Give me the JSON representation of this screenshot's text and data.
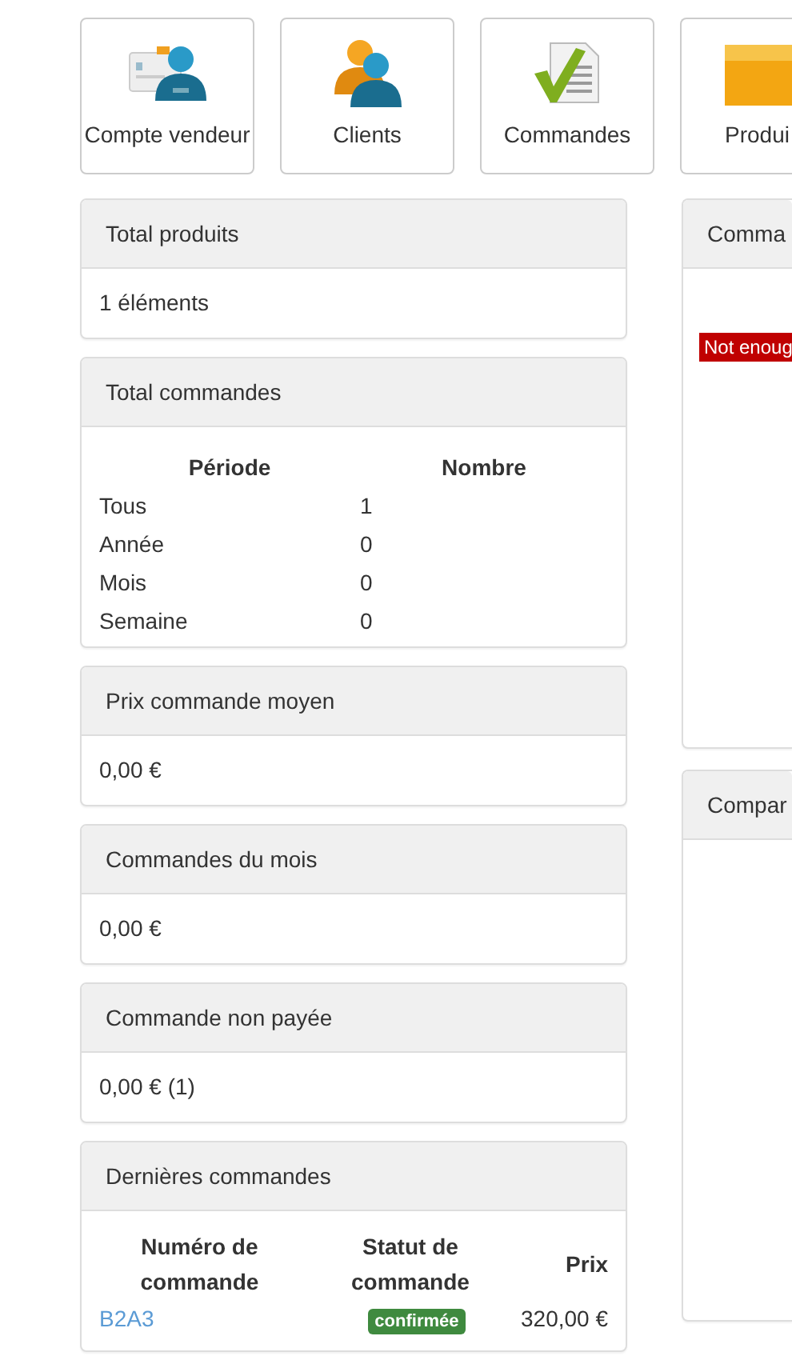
{
  "tiles": [
    {
      "label": "Compte vendeur",
      "kind": "account"
    },
    {
      "label": "Clients",
      "kind": "clients"
    },
    {
      "label": "Commandes",
      "kind": "orders"
    },
    {
      "label": "Produi",
      "kind": "products"
    }
  ],
  "left_panels": [
    {
      "title": "Total produits",
      "kind": "text",
      "value": "1 éléments"
    },
    {
      "title": "Total commandes",
      "kind": "period_table",
      "columns": [
        "Période",
        "Nombre"
      ],
      "rows": [
        [
          "Tous",
          "1"
        ],
        [
          "Année",
          "0"
        ],
        [
          "Mois",
          "0"
        ],
        [
          "Semaine",
          "0"
        ]
      ]
    },
    {
      "title": "Prix commande moyen",
      "kind": "text",
      "value": "0,00 €"
    },
    {
      "title": "Commandes du mois",
      "kind": "text",
      "value": "0,00 €"
    },
    {
      "title": "Commande non payée",
      "kind": "text",
      "value": "0,00 € (1)"
    },
    {
      "title": "Dernières commandes",
      "kind": "orders_table",
      "columns": [
        "Numéro de commande",
        "Statut de commande",
        "Prix"
      ],
      "rows": [
        {
          "number": "B2A3",
          "status": "confirmée",
          "price": "320,00 €"
        }
      ]
    }
  ],
  "right_panels": [
    {
      "title": "Comma",
      "alert": "Not enoug"
    },
    {
      "title": "Compar"
    }
  ]
}
